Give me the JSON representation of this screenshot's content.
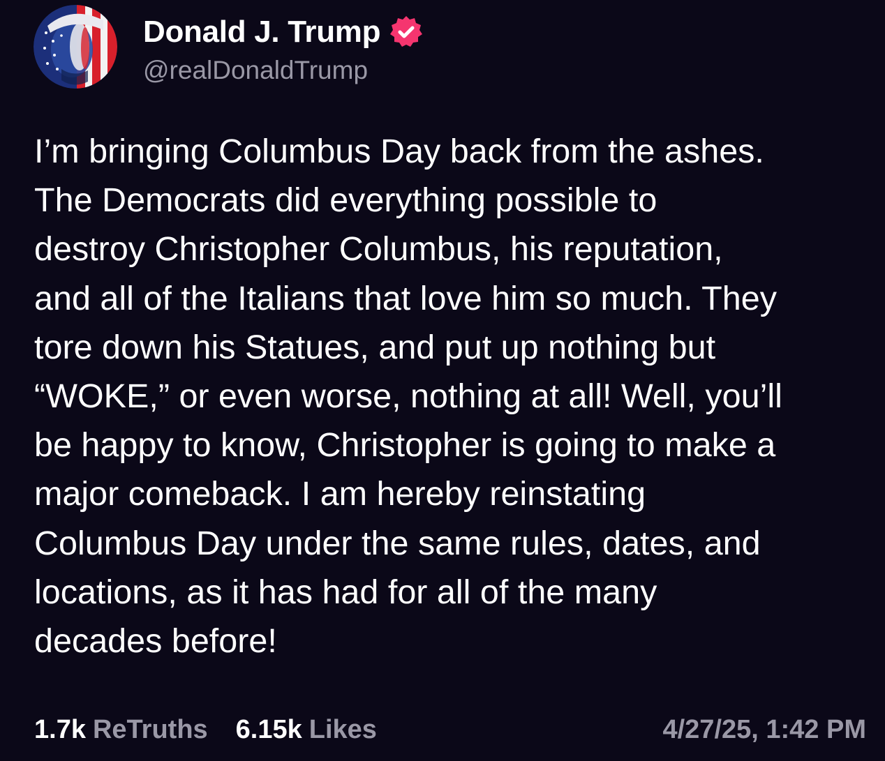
{
  "author": {
    "display_name": "Donald J. Trump",
    "handle": "@realDonaldTrump",
    "verified": true,
    "verified_icon": "verified-badge-icon",
    "avatar_icon": "flag-portrait-avatar"
  },
  "post": {
    "lines": [
      "I’m bringing Columbus Day back from the ashes.",
      "The Democrats did everything possible to",
      "destroy Christopher Columbus, his reputation,",
      "and all of the Italians that love him so much. They",
      "tore down his Statues, and put up nothing but",
      "“WOKE,” or even worse, nothing at all! Well, you’ll",
      "be happy to know, Christopher is going to make a",
      "major comeback. I am hereby reinstating",
      "Columbus Day under the same rules, dates, and",
      "locations, as it has had for all of the many",
      "decades before!"
    ]
  },
  "stats": {
    "retruths_count": "1.7k",
    "retruths_label": "ReTruths",
    "likes_count": "6.15k",
    "likes_label": "Likes"
  },
  "timestamp": "4/27/25, 1:42 PM",
  "colors": {
    "background": "#0b0818",
    "text": "#ffffff",
    "muted": "#9a98a6",
    "badge": "#f5356f"
  }
}
